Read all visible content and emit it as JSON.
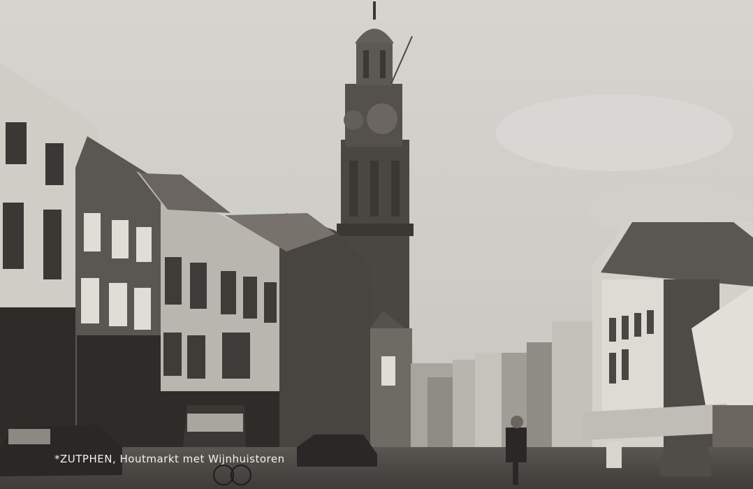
{
  "photo": {
    "subject": "Historic street scene with tall church tower",
    "tone": "black-and-white",
    "colors": {
      "sky": "#cfcdc8",
      "buildings_dark": "#3a3734",
      "street": "#4a4643"
    }
  },
  "caption": {
    "place": "*ZUTPHEN,",
    "title": "Houtmarkt met Wijnhuistoren"
  }
}
